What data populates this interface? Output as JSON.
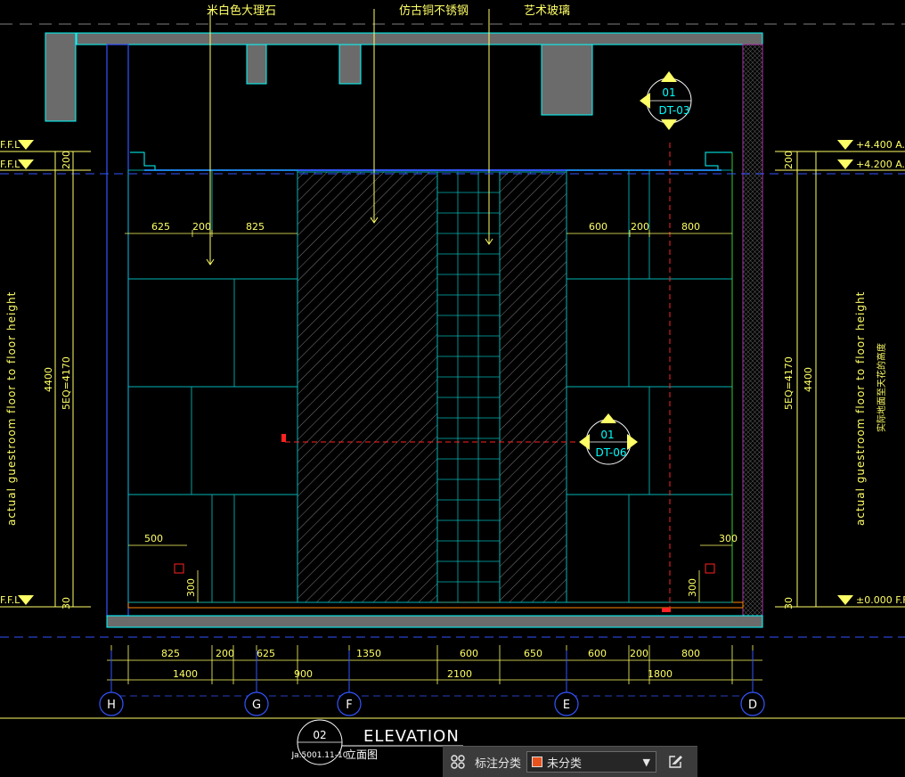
{
  "drawing": {
    "materials": [
      "米白色大理石",
      "仿古铜不锈钢",
      "艺术玻璃"
    ],
    "top_dims_left": [
      "625",
      "200",
      "825"
    ],
    "top_dims_right": [
      "600",
      "200",
      "800"
    ],
    "bottom_dims_row1": [
      "825",
      "200",
      "625",
      "1350",
      "600",
      "650",
      "600",
      "200",
      "800"
    ],
    "bottom_dims_row2": [
      "1400",
      "900",
      "2100",
      "1800"
    ],
    "grid_labels": [
      "H",
      "G",
      "F",
      "E",
      "D"
    ],
    "left_dims": {
      "total": "4400",
      "eq": "5EQ=4170",
      "top": "200",
      "bottom": "30",
      "small_w": "500",
      "small_h": "300"
    },
    "right_dims": {
      "total": "4400",
      "eq": "5EQ=4170",
      "top": "200",
      "bottom": "30",
      "small_w": "300",
      "small_h": "300"
    },
    "left_levels": [
      "F.F.L",
      "F.F.L",
      "F.F.L"
    ],
    "right_levels": [
      "+4.400 A.F.F.L",
      "+4.200 A.F.F.L",
      "±0.000 F.F.L"
    ],
    "vertical_note_left": "actual guestroom floor to floor height",
    "vertical_note_right": "actual guestroom floor to floor height",
    "vertical_note_right_cn": "实际地面至天花的高度",
    "callout_top": {
      "num": "01",
      "ref": "DT-03"
    },
    "callout_mid": {
      "num": "01",
      "ref": "DT-06"
    },
    "title": {
      "num": "02",
      "sheet": "Ja.5001.11-10",
      "en": "ELEVATION",
      "cn": "立面图"
    }
  },
  "statusbar": {
    "label": "标注分类",
    "value": "未分类",
    "swatch": "#e8521e"
  },
  "colors": {
    "wall": "#6b6b6b",
    "cyan": "#00ffff",
    "yellow": "#ffff66",
    "blue": "#3355ff",
    "red": "#ff2222",
    "panel": "#00b3b3"
  }
}
